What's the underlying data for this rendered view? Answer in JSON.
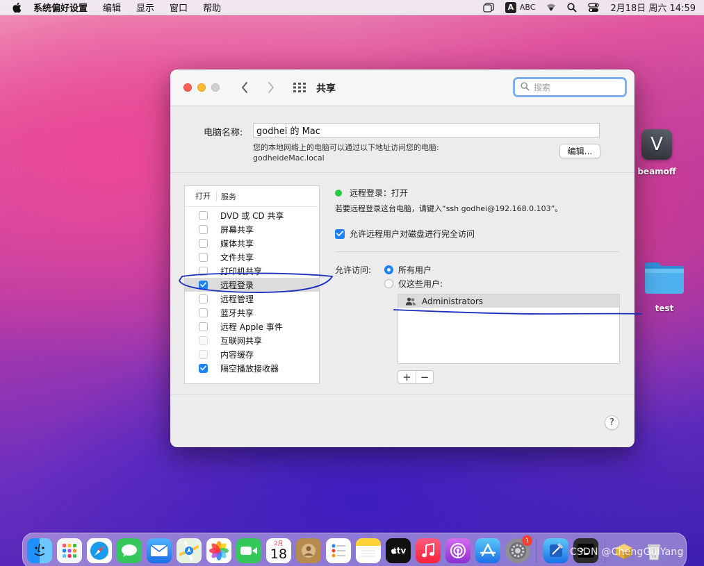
{
  "menubar": {
    "app_name": "系统偏好设置",
    "items": [
      "编辑",
      "显示",
      "窗口",
      "帮助"
    ],
    "input_letter": "A",
    "input_method": "ABC",
    "datetime": "2月18日 周六  14:59"
  },
  "desktop": {
    "icons": [
      {
        "label": "beamoff",
        "glyph": "V"
      },
      {
        "label": "test"
      }
    ]
  },
  "window": {
    "title": "共享",
    "search_placeholder": "搜索",
    "computer_name_label": "电脑名称:",
    "computer_name_value": "godhei 的 Mac",
    "address_desc_line1": "您的本地网络上的电脑可以通过以下地址访问您的电脑:",
    "address_desc_line2": "godheideMac.local",
    "edit_button": "编辑...",
    "list_header_on": "打开",
    "list_header_service": "服务",
    "services": [
      {
        "name": "DVD 或 CD 共享",
        "checked": false,
        "enabled": true,
        "selected": false
      },
      {
        "name": "屏幕共享",
        "checked": false,
        "enabled": true,
        "selected": false
      },
      {
        "name": "媒体共享",
        "checked": false,
        "enabled": true,
        "selected": false
      },
      {
        "name": "文件共享",
        "checked": false,
        "enabled": true,
        "selected": false
      },
      {
        "name": "打印机共享",
        "checked": false,
        "enabled": true,
        "selected": false
      },
      {
        "name": "远程登录",
        "checked": true,
        "enabled": true,
        "selected": true
      },
      {
        "name": "远程管理",
        "checked": false,
        "enabled": true,
        "selected": false
      },
      {
        "name": "蓝牙共享",
        "checked": false,
        "enabled": true,
        "selected": false
      },
      {
        "name": "远程 Apple 事件",
        "checked": false,
        "enabled": true,
        "selected": false
      },
      {
        "name": "互联网共享",
        "checked": false,
        "enabled": false,
        "selected": false
      },
      {
        "name": "内容缓存",
        "checked": false,
        "enabled": false,
        "selected": false
      },
      {
        "name": "隔空播放接收器",
        "checked": true,
        "enabled": true,
        "selected": false
      }
    ],
    "status_text": "远程登录：打开",
    "status_desc": "若要远程登录这台电脑，请键入“ssh godhei@192.168.0.103”。",
    "full_disk_access_label": "允许远程用户对磁盘进行完全访问",
    "allow_access_label": "允许访问:",
    "radio_all_users": "所有用户",
    "radio_only_users": "仅这些用户:",
    "users": [
      "Administrators"
    ],
    "add_button": "+",
    "remove_button": "−",
    "help_button": "?"
  },
  "watermark": "CSDN @ChengGuiYang",
  "dock": {
    "calendar_month": "2月",
    "calendar_day": "18",
    "tv_label": "tv",
    "settings_badge": "1"
  },
  "colors": {
    "accent": "#1a82fb",
    "status_on": "#28c840",
    "annotation_ink": "#1d2fbf"
  }
}
